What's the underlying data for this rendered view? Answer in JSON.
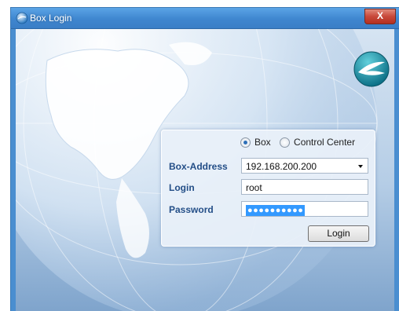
{
  "window": {
    "title": "Box Login",
    "close_label": "X"
  },
  "mode": {
    "options": [
      {
        "label": "Box",
        "selected": true
      },
      {
        "label": "Control Center",
        "selected": false
      }
    ]
  },
  "form": {
    "box_address": {
      "label": "Box-Address",
      "value": "192.168.200.200"
    },
    "login": {
      "label": "Login",
      "value": "root"
    },
    "password": {
      "label": "Password",
      "masked_value": "●●●●●●●●●●"
    },
    "submit_label": "Login"
  },
  "colors": {
    "titlebar": "#3f86cf",
    "label": "#234e87",
    "close": "#c8483a",
    "selection": "#3399ff"
  },
  "icons": [
    "box-app-icon",
    "close-icon",
    "brand-logo-icon",
    "globe-background",
    "dropdown-arrow-icon"
  ]
}
